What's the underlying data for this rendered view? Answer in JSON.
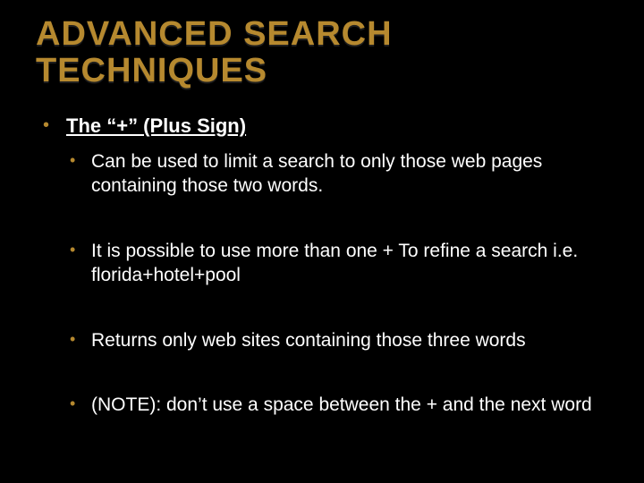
{
  "title": "ADVANCED SEARCH TECHNIQUES",
  "bullets": {
    "l1": "The  “+” (Plus Sign)",
    "l2": [
      "Can be used to limit a search to only those web pages containing those two words.",
      "It is possible to use more than one + To refine a search i.e. florida+hotel+pool",
      "Returns only web sites containing those three words",
      "(NOTE): don’t use a space between the + and the next word"
    ]
  }
}
